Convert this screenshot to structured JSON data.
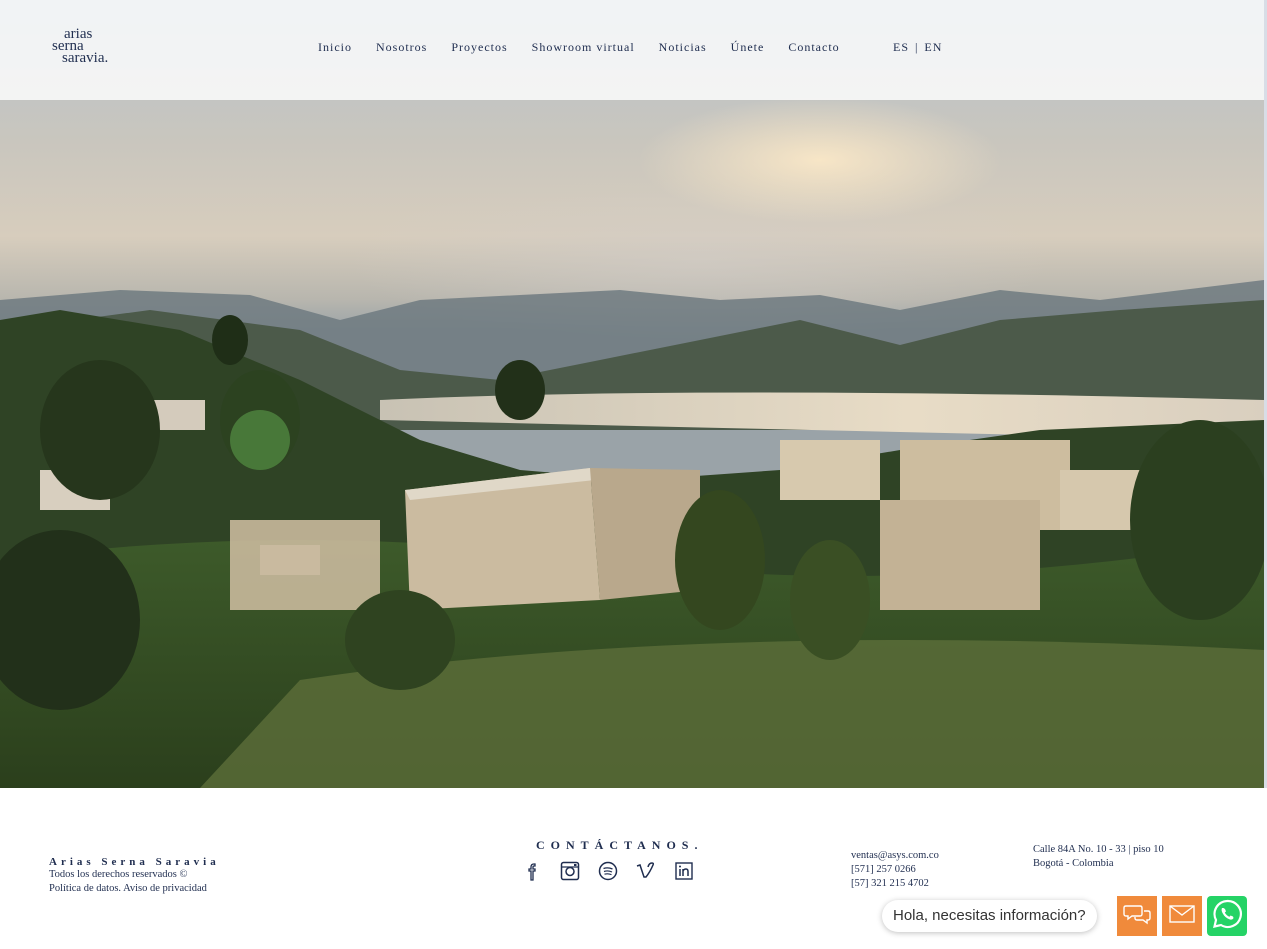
{
  "logo": {
    "line1": "arias",
    "line2": "serna",
    "line3": "saravia."
  },
  "nav": {
    "items": [
      "Inicio",
      "Nosotros",
      "Proyectos",
      "Showroom virtual",
      "Noticias",
      "Únete",
      "Contacto"
    ],
    "lang_es": "ES",
    "lang_sep": "|",
    "lang_en": "EN"
  },
  "footer": {
    "company": "Arias Serna Saravia",
    "rights": "Todos los derechos reservados ©",
    "privacy": "Política de datos. Aviso de privacidad",
    "contact_title": "CONTÁCTANOS.",
    "socials": [
      "facebook-icon",
      "instagram-icon",
      "spotify-icon",
      "vimeo-icon",
      "linkedin-icon"
    ],
    "email": "ventas@asys.com.co",
    "phone1": "[571] 257 0266",
    "phone2": "[57] 321 215 4702",
    "address1": "Calle 84A No. 10 - 33 | piso 10",
    "address2": "Bogotá - Colombia"
  },
  "widget": {
    "prompt": "Hola, necesitas información?",
    "chat_color": "#f08a3b",
    "whatsapp_color": "#25d366"
  }
}
